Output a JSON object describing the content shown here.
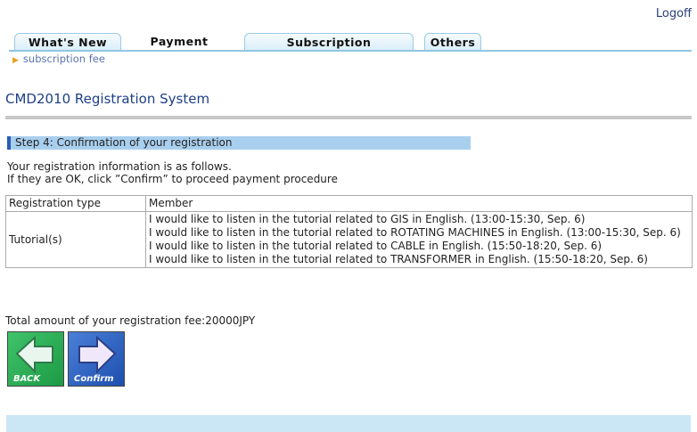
{
  "header": {
    "logoff_label": "Logoff"
  },
  "tabs": [
    {
      "label": "What's New"
    },
    {
      "label": "Payment"
    },
    {
      "label": "Subscription"
    },
    {
      "label": "Others"
    }
  ],
  "subnav": {
    "link_label": "subscription fee"
  },
  "page": {
    "title": "CMD2010 Registration System"
  },
  "step": {
    "label": "Step 4: Confirmation of your registration"
  },
  "info": {
    "line1": "Your registration information is as follows.",
    "line2": "If they are OK, click ”Confirm” to proceed payment procedure"
  },
  "table": {
    "reg_type_label": "Registration type",
    "reg_type_value": "Member",
    "tutorial_label": "Tutorial(s)",
    "tutorials": [
      "I would like to listen in the tutorial related to GIS in English. (13:00-15:30, Sep. 6)",
      "I would like to listen in the tutorial related to ROTATING MACHINES in English. (13:00-15:30, Sep. 6)",
      "I would like to listen in the tutorial related to CABLE in English. (15:50-18:20, Sep. 6)",
      "I would like to listen in the tutorial related to TRANSFORMER in English. (15:50-18:20, Sep. 6)"
    ]
  },
  "total": {
    "text": "Total amount of your registration fee:20000JPY"
  },
  "buttons": {
    "back_label": "BACK",
    "confirm_label": "Confirm"
  }
}
